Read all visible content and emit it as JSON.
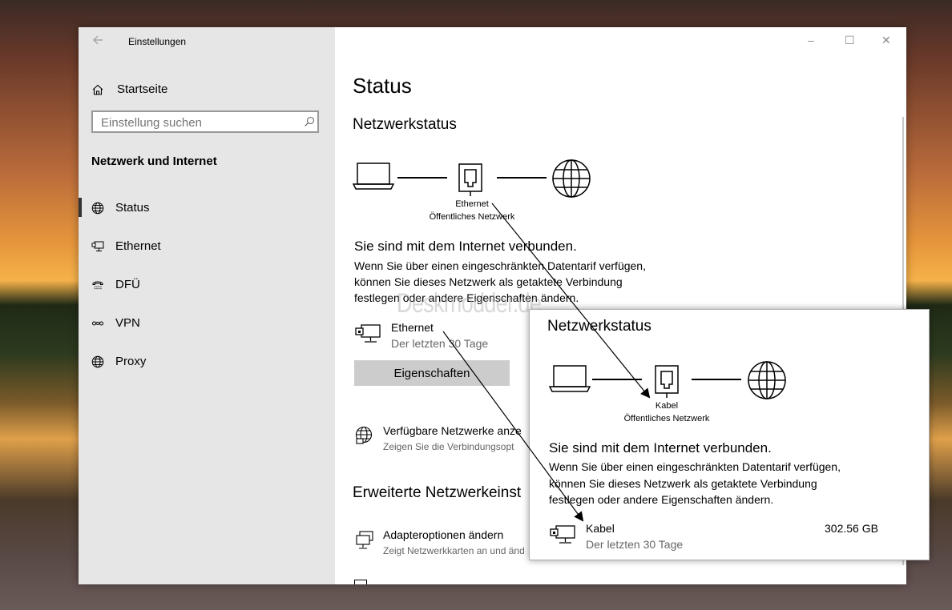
{
  "window": {
    "title": "Einstellungen",
    "controls": {
      "minimize": "–",
      "maximize": "☐",
      "close": "✕"
    }
  },
  "sidebar": {
    "home": "Startseite",
    "search_placeholder": "Einstellung suchen",
    "section_title": "Netzwerk und Internet",
    "items": [
      {
        "label": "Status",
        "icon": "globe-icon",
        "selected": true
      },
      {
        "label": "Ethernet",
        "icon": "ethernet-icon"
      },
      {
        "label": "DFÜ",
        "icon": "dialup-icon"
      },
      {
        "label": "VPN",
        "icon": "vpn-icon"
      },
      {
        "label": "Proxy",
        "icon": "globe-icon"
      }
    ]
  },
  "main": {
    "page_title": "Status",
    "network_status_heading": "Netzwerkstatus",
    "diagram": {
      "adapter": "Ethernet",
      "network_type": "Öffentliches Netzwerk"
    },
    "connected_heading": "Sie sind mit dem Internet verbunden.",
    "connected_text": [
      "Wenn Sie über einen eingeschränkten Datentarif verfügen,",
      "können Sie dieses Netzwerk als getaktete Verbindung",
      "festlegen oder andere Eigenschaften ändern."
    ],
    "connection": {
      "name": "Ethernet",
      "period": "Der letzten 30 Tage"
    },
    "properties_button": "Eigenschaften",
    "available_networks": {
      "title": "Verfügbare Netzwerke anze",
      "subtitle": "Zeigen Sie die Verbindungsopt"
    },
    "advanced_heading": "Erweiterte Netzwerkeinst",
    "adapter_options": {
      "title": "Adapteroptionen ändern",
      "subtitle": "Zeigt Netzwerkkarten an und änd"
    }
  },
  "popup": {
    "heading": "Netzwerkstatus",
    "diagram": {
      "adapter": "Kabel",
      "network_type": "Öffentliches Netzwerk"
    },
    "connected_heading": "Sie sind mit dem Internet verbunden.",
    "connected_text": [
      "Wenn Sie über einen eingeschränkten Datentarif verfügen,",
      "können Sie dieses Netzwerk als getaktete Verbindung",
      "festlegen oder andere Eigenschaften ändern."
    ],
    "connection": {
      "name": "Kabel",
      "period": "Der letzten 30 Tage",
      "usage": "302.56 GB"
    }
  },
  "watermark": "Deskmodder.de",
  "colors": {
    "sidebar_bg": "#e6e6e6",
    "button_bg": "#cccccc",
    "text": "#000000",
    "secondary_text": "#666666"
  }
}
